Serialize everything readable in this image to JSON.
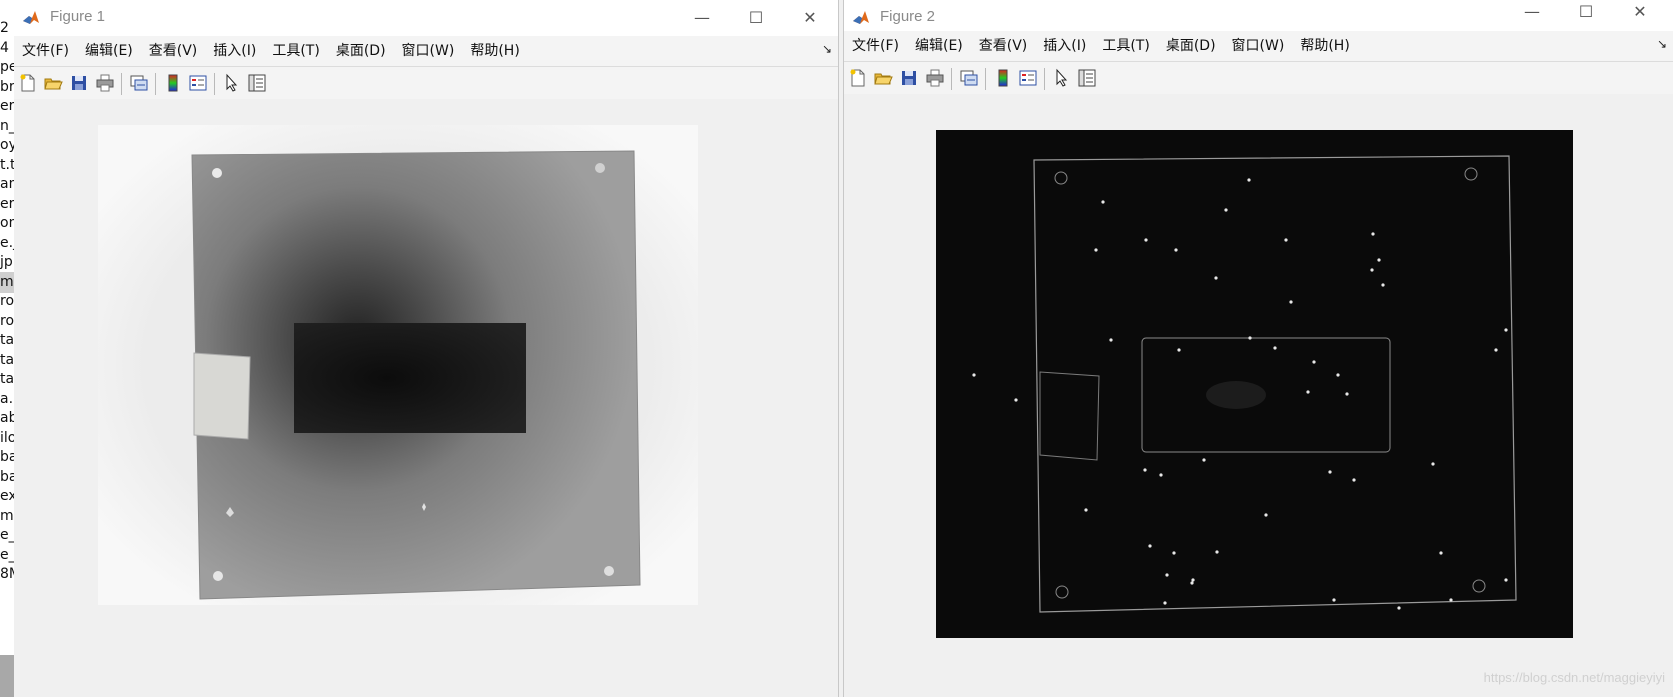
{
  "background_list": {
    "rows": [
      "2",
      "4",
      "pe",
      "bri",
      "era",
      "n_a",
      "oy",
      "t.t",
      "am",
      "er.",
      "om",
      "e.j",
      "jp",
      "m",
      "ro",
      "ro",
      "ta.",
      "ta.",
      "ta_",
      "a.b",
      "ab",
      "ilo",
      "ba",
      "ba",
      "ex",
      "m",
      "e_",
      "e_",
      "8M"
    ],
    "selected_index": 13
  },
  "figure1": {
    "title": "Figure 1",
    "menu": [
      "文件(F)",
      "编辑(E)",
      "查看(V)",
      "插入(I)",
      "工具(T)",
      "桌面(D)",
      "窗口(W)",
      "帮助(H)"
    ],
    "menu_arrow": "↘",
    "controls": {
      "minimize": "—",
      "maximize": "☐",
      "close": "✕"
    },
    "image_description_icon": "grayscale-xray-image"
  },
  "figure2": {
    "title": "Figure 2",
    "menu": [
      "文件(F)",
      "编辑(E)",
      "查看(V)",
      "插入(I)",
      "工具(T)",
      "桌面(D)",
      "窗口(W)",
      "帮助(H)"
    ],
    "menu_arrow": "↘",
    "controls": {
      "minimize": "—",
      "maximize": "☐",
      "close": "✕"
    },
    "image_description_icon": "edge-detected-image"
  },
  "toolbar_icons": [
    "new-figure-icon",
    "open-file-icon",
    "save-icon",
    "print-icon",
    "link-plot-icon",
    "colorbar-icon",
    "legend-icon",
    "edit-plot-arrow-icon",
    "property-inspector-icon"
  ],
  "watermark": "https://blog.csdn.net/maggieyiyi",
  "colors": {
    "window_bg": "#f0f0f0",
    "titlebar_bg": "#ffffff",
    "fig1_plate": "#9a9a9a",
    "fig2_bg": "#0a0a0a"
  }
}
